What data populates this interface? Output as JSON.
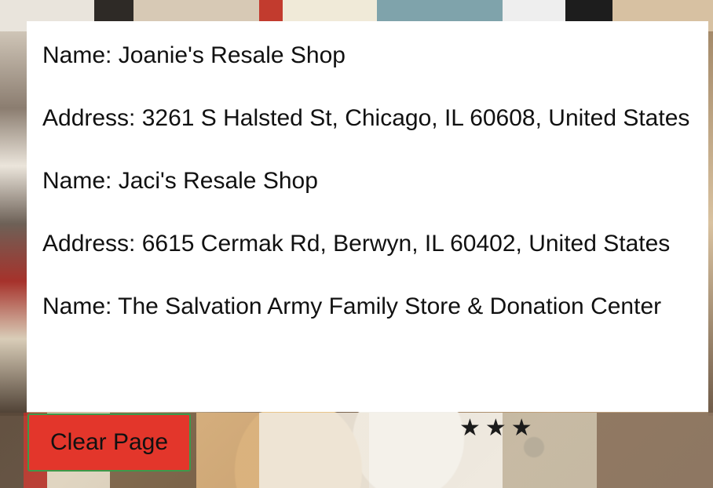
{
  "results": [
    {
      "name_line": "Name: Joanie's Resale Shop",
      "address_line": "Address: 3261 S Halsted St, Chicago, IL 60608, United States"
    },
    {
      "name_line": "Name: Jaci's Resale Shop",
      "address_line": "Address: 6615 Cermak Rd, Berwyn, IL 60402, United States"
    },
    {
      "name_line": "Name: The Salvation Army Family Store & Donation Center",
      "address_line": ""
    }
  ],
  "clear_button": {
    "label": "Clear Page"
  },
  "decor": {
    "stars": "★★★"
  },
  "colors": {
    "button_bg": "#e3362b",
    "button_border": "#3c9a4a",
    "panel_bg": "#ffffff"
  }
}
